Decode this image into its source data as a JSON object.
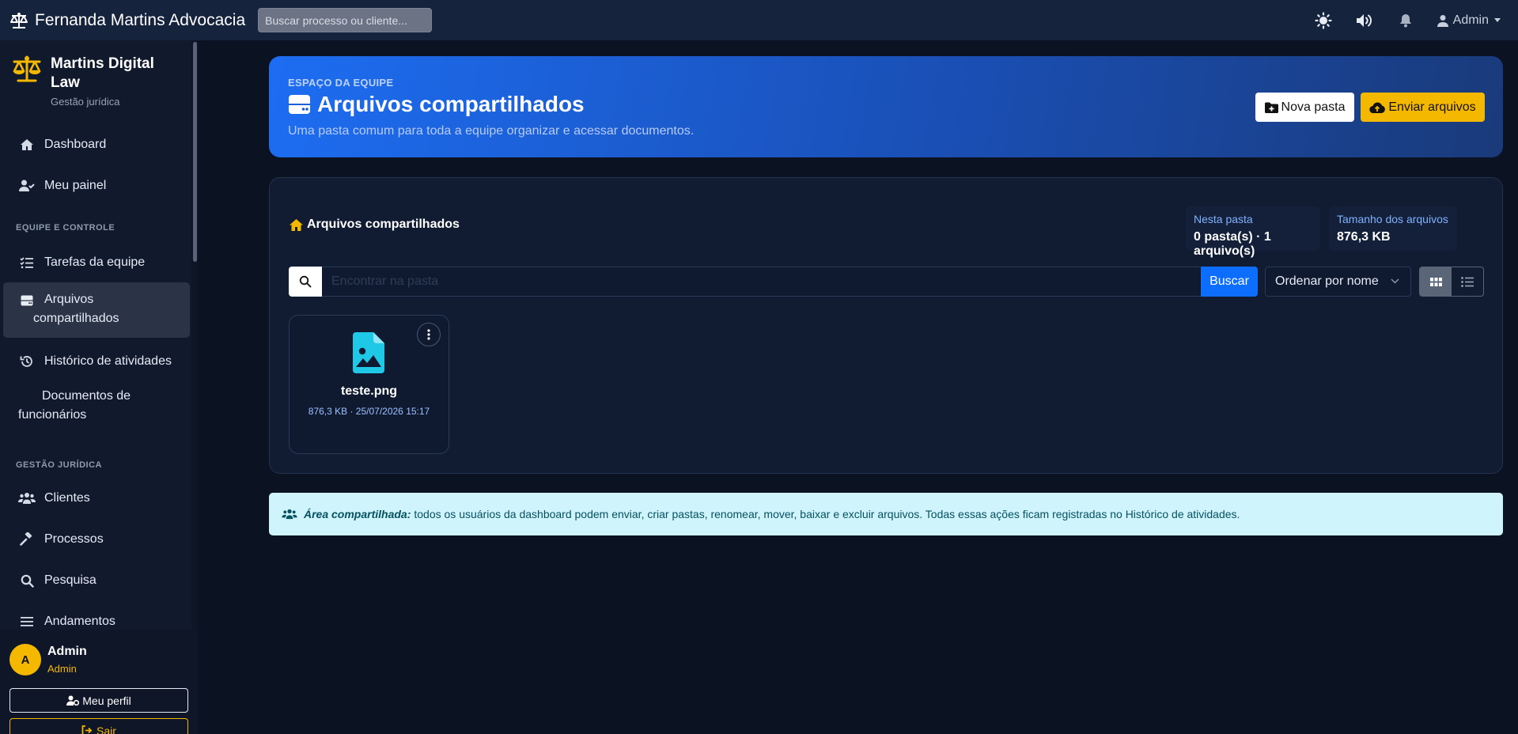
{
  "topbar": {
    "brand": "Fernanda Martins Advocacia",
    "search_placeholder": "Buscar processo ou cliente...",
    "user_label": "Admin"
  },
  "sidebar": {
    "brand_title": "Martins Digital Law",
    "brand_subtitle": "Gestão jurídica",
    "items_top": [
      {
        "label": "Dashboard",
        "icon": "home-icon"
      },
      {
        "label": "Meu painel",
        "icon": "user-check-icon"
      }
    ],
    "section_team": "EQUIPE E CONTROLE",
    "items_team": [
      {
        "label": "Tarefas da equipe",
        "icon": "list-check-icon"
      },
      {
        "label": "Arquivos compartilhados",
        "icon": "hard-drive-icon",
        "active": true
      },
      {
        "label": "Histórico de atividades",
        "icon": "history-icon"
      },
      {
        "label": "Documentos de funcionários",
        "icon": ""
      }
    ],
    "section_legal": "GESTÃO JURÍDICA",
    "items_legal": [
      {
        "label": "Clientes",
        "icon": "users-icon"
      },
      {
        "label": "Processos",
        "icon": "gavel-icon"
      },
      {
        "label": "Pesquisa",
        "icon": "search-icon"
      },
      {
        "label": "Andamentos",
        "icon": "bars-icon"
      }
    ],
    "user": {
      "initial": "A",
      "name": "Admin",
      "role": "Admin",
      "profile_label": "Meu perfil",
      "logout_label": "Sair"
    }
  },
  "hero": {
    "kicker": "ESPAÇO DA EQUIPE",
    "title": "Arquivos compartilhados",
    "subtitle": "Uma pasta comum para toda a equipe organizar e acessar documentos.",
    "new_folder_label": "Nova pasta",
    "upload_label": "Enviar arquivos"
  },
  "panel": {
    "breadcrumb": "Arquivos compartilhados",
    "stats": [
      {
        "label": "Nesta pasta",
        "value": "0 pasta(s) · 1 arquivo(s)"
      },
      {
        "label": "Tamanho dos arquivos",
        "value": "876,3 KB"
      }
    ],
    "search_placeholder": "Encontrar na pasta",
    "search_button": "Buscar",
    "sort_selected": "Ordenar por nome",
    "view_mode": "grid",
    "files": [
      {
        "name": "teste.png",
        "meta": "876,3 KB · 25/07/2026 15:17",
        "icon": "file-image-icon"
      }
    ]
  },
  "info": {
    "bold": "Área compartilhada:",
    "text": "todos os usuários da dashboard podem enviar, criar pastas, renomear, mover, baixar e excluir arquivos. Todas essas ações ficam registradas no Histórico de atividades."
  },
  "colors": {
    "accent_blue": "#0d6efd",
    "accent_yellow": "#f5b800",
    "file_icon": "#1ec8e6",
    "info_bg": "#cff4fc"
  }
}
